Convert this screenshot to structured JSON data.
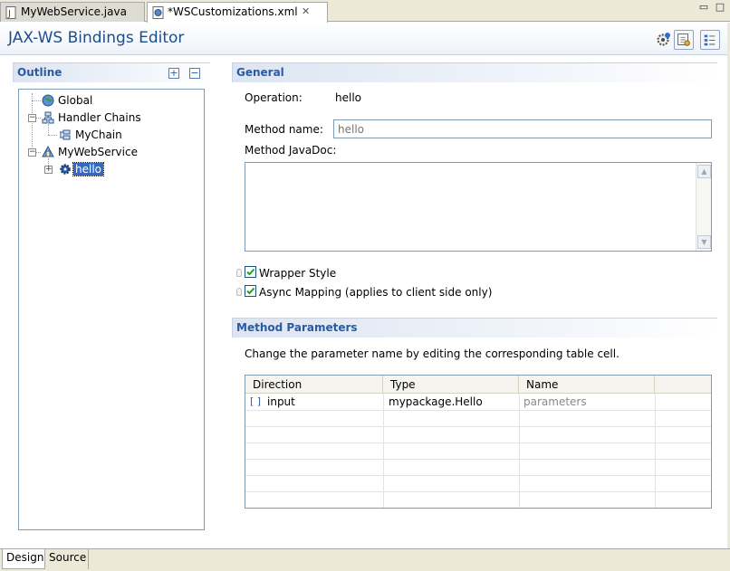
{
  "tabs": [
    {
      "label": "MyWebService.java",
      "icon": "java-file-icon",
      "active": false
    },
    {
      "label": "*WSCustomizations.xml",
      "icon": "xml-file-icon",
      "active": true,
      "closable": true
    }
  ],
  "window_controls": {
    "minimize": "▭",
    "maximize": "□"
  },
  "header": {
    "title": "JAX-WS Bindings Editor"
  },
  "outline": {
    "title": "Outline",
    "expand_all": "+",
    "collapse_all": "−",
    "tree": [
      {
        "label": "Global",
        "icon": "globe-icon"
      },
      {
        "label": "Handler Chains",
        "icon": "handler-chains-icon"
      },
      {
        "label": "MyChain",
        "icon": "chain-icon"
      },
      {
        "label": "MyWebService",
        "icon": "web-service-icon"
      },
      {
        "label": "hello",
        "icon": "operation-gear-icon",
        "selected": true
      }
    ]
  },
  "general": {
    "title": "General",
    "operation_label": "Operation:",
    "operation_value": "hello",
    "method_name_label": "Method name:",
    "method_name_placeholder": "hello",
    "method_javadoc_label": "Method JavaDoc:",
    "method_javadoc_value": "",
    "wrapper_style_label": "Wrapper Style",
    "wrapper_style_checked": true,
    "async_mapping_label": "Async Mapping (applies to client side only)",
    "async_mapping_checked": true
  },
  "parameters": {
    "title": "Method Parameters",
    "hint": "Change the parameter name by editing the corresponding table cell.",
    "columns": [
      "Direction",
      "Type",
      "Name"
    ],
    "rows": [
      {
        "direction": "input",
        "type": "mypackage.Hello",
        "name": "parameters"
      }
    ]
  },
  "bottom_tabs": [
    {
      "label": "Design",
      "active": true
    },
    {
      "label": "Source",
      "active": false
    }
  ],
  "colors": {
    "accent": "#2a5aa2",
    "title": "#1c4e8c",
    "selection": "#316ac5"
  }
}
